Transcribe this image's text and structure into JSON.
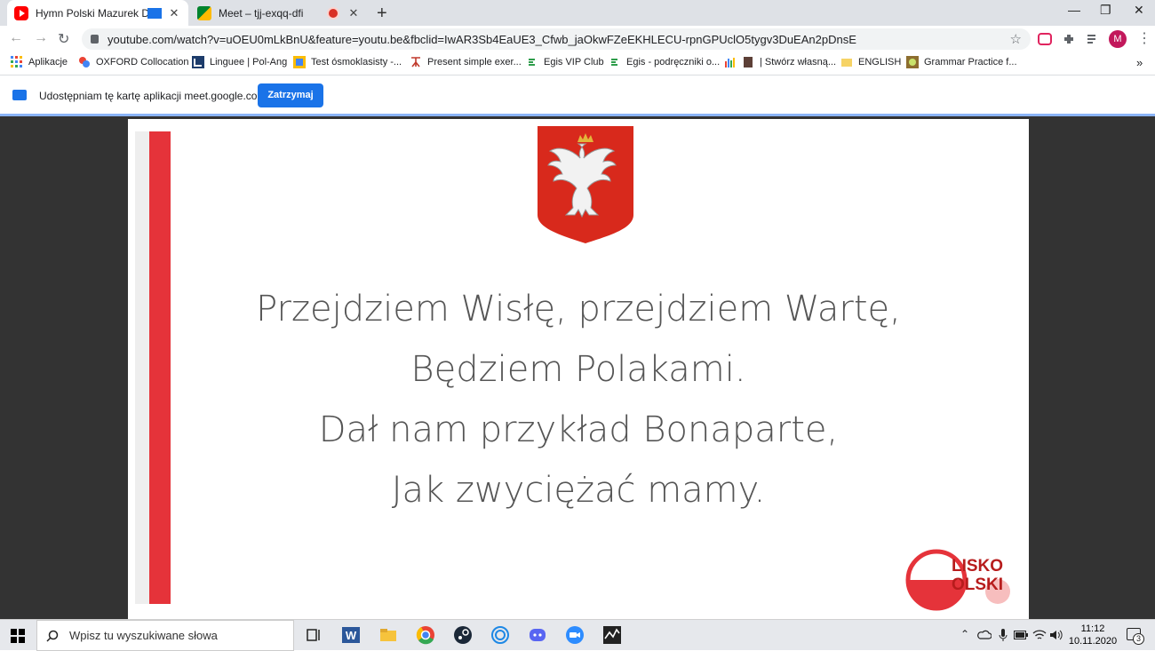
{
  "tabs": [
    {
      "title": "Hymn Polski Mazurek Dąbro",
      "close": "✕"
    },
    {
      "title": "Meet – tjj-exqq-dfi",
      "close": "✕"
    }
  ],
  "new_tab": "+",
  "window_controls": {
    "minimize": "—",
    "maximize": "❐",
    "close": "✕"
  },
  "address": {
    "url": "youtube.com/watch?v=uOEU0mLkBnU&feature=youtu.be&fbclid=IwAR3Sb4EaUE3_Cfwb_jaOkwFZeEKHLECU-rpnGPUclO5tygv3DuEAn2pDnsE"
  },
  "profile": {
    "initial": "M"
  },
  "bookmarks": [
    "Aplikacje",
    "OXFORD Collocation",
    "Linguee | Pol-Ang",
    "Test ósmoklasisty -...",
    "Present simple exer...",
    "Egis VIP Club",
    "Egis - podręczniki o...",
    "| Stwórz własną...",
    "ENGLISH",
    "Grammar Practice f..."
  ],
  "bookmarks_more": "»",
  "share_bar": {
    "text": "Udostępniam tę kartę aplikacji meet.google.com",
    "button": "Zatrzymaj"
  },
  "slide": {
    "lines": [
      "Przejdziem Wisłę, przejdziem Wartę,",
      "Będziem Polakami.",
      "Dał nam przykład Bonaparte,",
      "Jak zwyciężać mamy."
    ],
    "logo_text": [
      "LISKO",
      "OLSKI"
    ]
  },
  "taskbar": {
    "search_placeholder": "Wpisz tu wyszukiwane słowa",
    "time": "11:12",
    "date": "10.11.2020",
    "notifications": "3"
  },
  "colors": {
    "accent": "#1a73e8",
    "flag_red": "#e5333a",
    "emblem_red": "#d8291c"
  }
}
